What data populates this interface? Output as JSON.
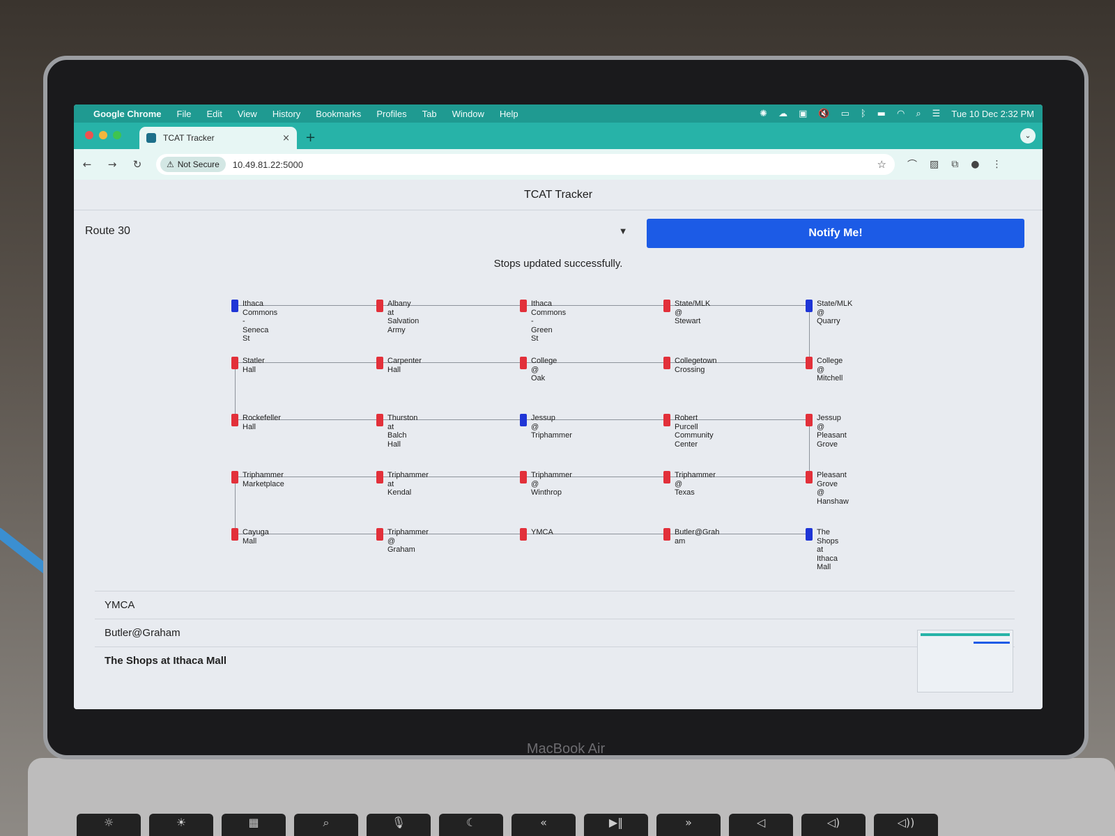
{
  "bezel_label": "MacBook Air",
  "menubar": {
    "apple": "",
    "items": [
      "Google Chrome",
      "File",
      "Edit",
      "View",
      "History",
      "Bookmarks",
      "Profiles",
      "Tab",
      "Window",
      "Help"
    ],
    "clock": "Tue 10 Dec  2:32 PM"
  },
  "browser": {
    "tab_title": "TCAT Tracker",
    "tab_close": "×",
    "new_tab": "+",
    "security_label": "Not Secure",
    "url": "10.49.81.22:5000"
  },
  "page": {
    "header": "TCAT Tracker",
    "route_select": "Route 30",
    "notify_button": "Notify Me!",
    "status_message": "Stops updated successfully."
  },
  "stops": [
    [
      "Ithaca\nCommons\n-\nSeneca\nSt",
      "Albany\nat\nSalvation\nArmy",
      "Ithaca\nCommons\n-\nGreen\nSt",
      "State/MLK\n@\nStewart",
      "State/MLK\n@\nQuarry"
    ],
    [
      "Statler\nHall",
      "Carpenter\nHall",
      "College\n@\nOak",
      "Collegetown\nCrossing",
      "College\n@\nMitchell"
    ],
    [
      "Rockefeller\nHall",
      "Thurston\nat\nBalch\nHall",
      "Jessup\n@\nTriphammer",
      "Robert\nPurcell\nCommunity\nCenter",
      "Jessup\n@\nPleasant\nGrove"
    ],
    [
      "Triphammer\nMarketplace",
      "Triphammer\nat\nKendal",
      "Triphammer\n@\nWinthrop",
      "Triphammer\n@\nTexas",
      "Pleasant\nGrove\n@\nHanshaw"
    ],
    [
      "Cayuga\nMall",
      "Triphammer\n@\nGraham",
      "YMCA",
      "Butler@Grah\nam",
      "The\nShops\nat\nIthaca\nMall"
    ]
  ],
  "stop_colors": [
    [
      "blue",
      "red",
      "red",
      "red",
      "blue"
    ],
    [
      "red",
      "red",
      "red",
      "red",
      "red"
    ],
    [
      "red",
      "red",
      "blue",
      "red",
      "red"
    ],
    [
      "red",
      "red",
      "red",
      "red",
      "red"
    ],
    [
      "red",
      "red",
      "red",
      "red",
      "blue"
    ]
  ],
  "list_items": [
    "YMCA",
    "Butler@Graham",
    "The Shops at Ithaca Mall"
  ],
  "colors": {
    "menubar": "#1f9a91",
    "notify": "#1c5be6",
    "marker_red": "#e2303a",
    "marker_blue": "#1f35d6"
  }
}
